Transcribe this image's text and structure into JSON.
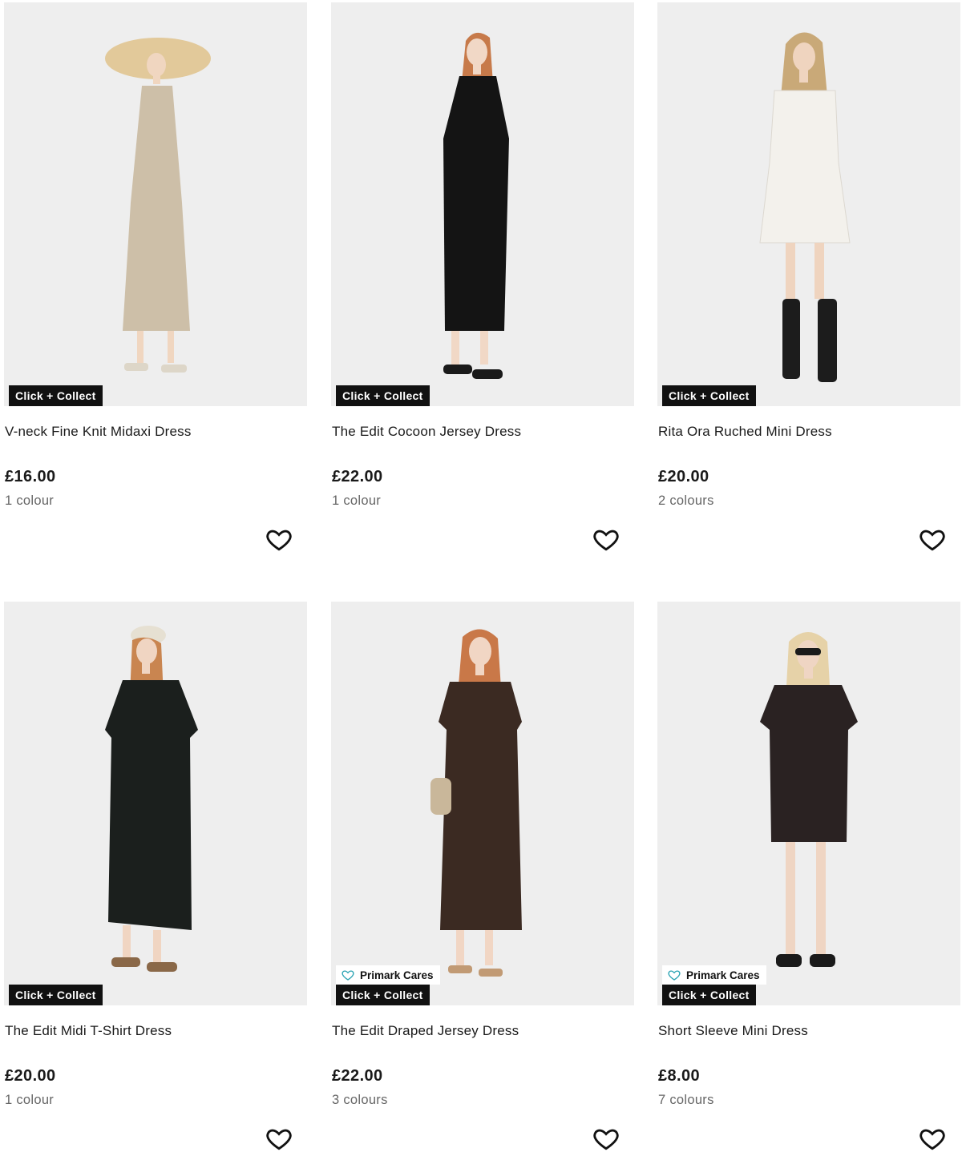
{
  "products": [
    {
      "name": "V-neck Fine Knit Midaxi Dress",
      "price": "£16.00",
      "colours": "1 colour",
      "badges": [
        "Click + Collect"
      ],
      "dress_color": "#cdbfa8",
      "style": "midaxi-knit",
      "accessory": "straw-hat"
    },
    {
      "name": "The Edit Cocoon Jersey Dress",
      "price": "£22.00",
      "colours": "1 colour",
      "badges": [
        "Click + Collect"
      ],
      "dress_color": "#141414",
      "style": "cocoon",
      "accessory": "none"
    },
    {
      "name": "Rita Ora Ruched Mini Dress",
      "price": "£20.00",
      "colours": "2 colours",
      "badges": [
        "Click + Collect"
      ],
      "dress_color": "#f3f1ec",
      "style": "mini",
      "accessory": "boots"
    },
    {
      "name": "The Edit Midi T-Shirt Dress",
      "price": "£20.00",
      "colours": "1 colour",
      "badges": [
        "Click + Collect"
      ],
      "dress_color": "#1b1f1d",
      "style": "tshirt-midi",
      "accessory": "cap"
    },
    {
      "name": "The Edit Draped Jersey Dress",
      "price": "£22.00",
      "colours": "3 colours",
      "badges": [
        "Primark Cares",
        "Click + Collect"
      ],
      "dress_color": "#3b2a22",
      "style": "draped",
      "accessory": "clutch"
    },
    {
      "name": "Short Sleeve Mini Dress",
      "price": "£8.00",
      "colours": "7 colours",
      "badges": [
        "Primark Cares",
        "Click + Collect"
      ],
      "dress_color": "#2a2222",
      "style": "floral-mini",
      "accessory": "sunglasses"
    }
  ],
  "icons": {
    "wishlist": "heart-outline-icon",
    "primark_cares": "heart-leaf-icon"
  },
  "colors": {
    "badge_bg": "#111111",
    "badge_text": "#ffffff",
    "image_bg": "#eeeeee",
    "cares_icon": "#2aa3b3"
  }
}
